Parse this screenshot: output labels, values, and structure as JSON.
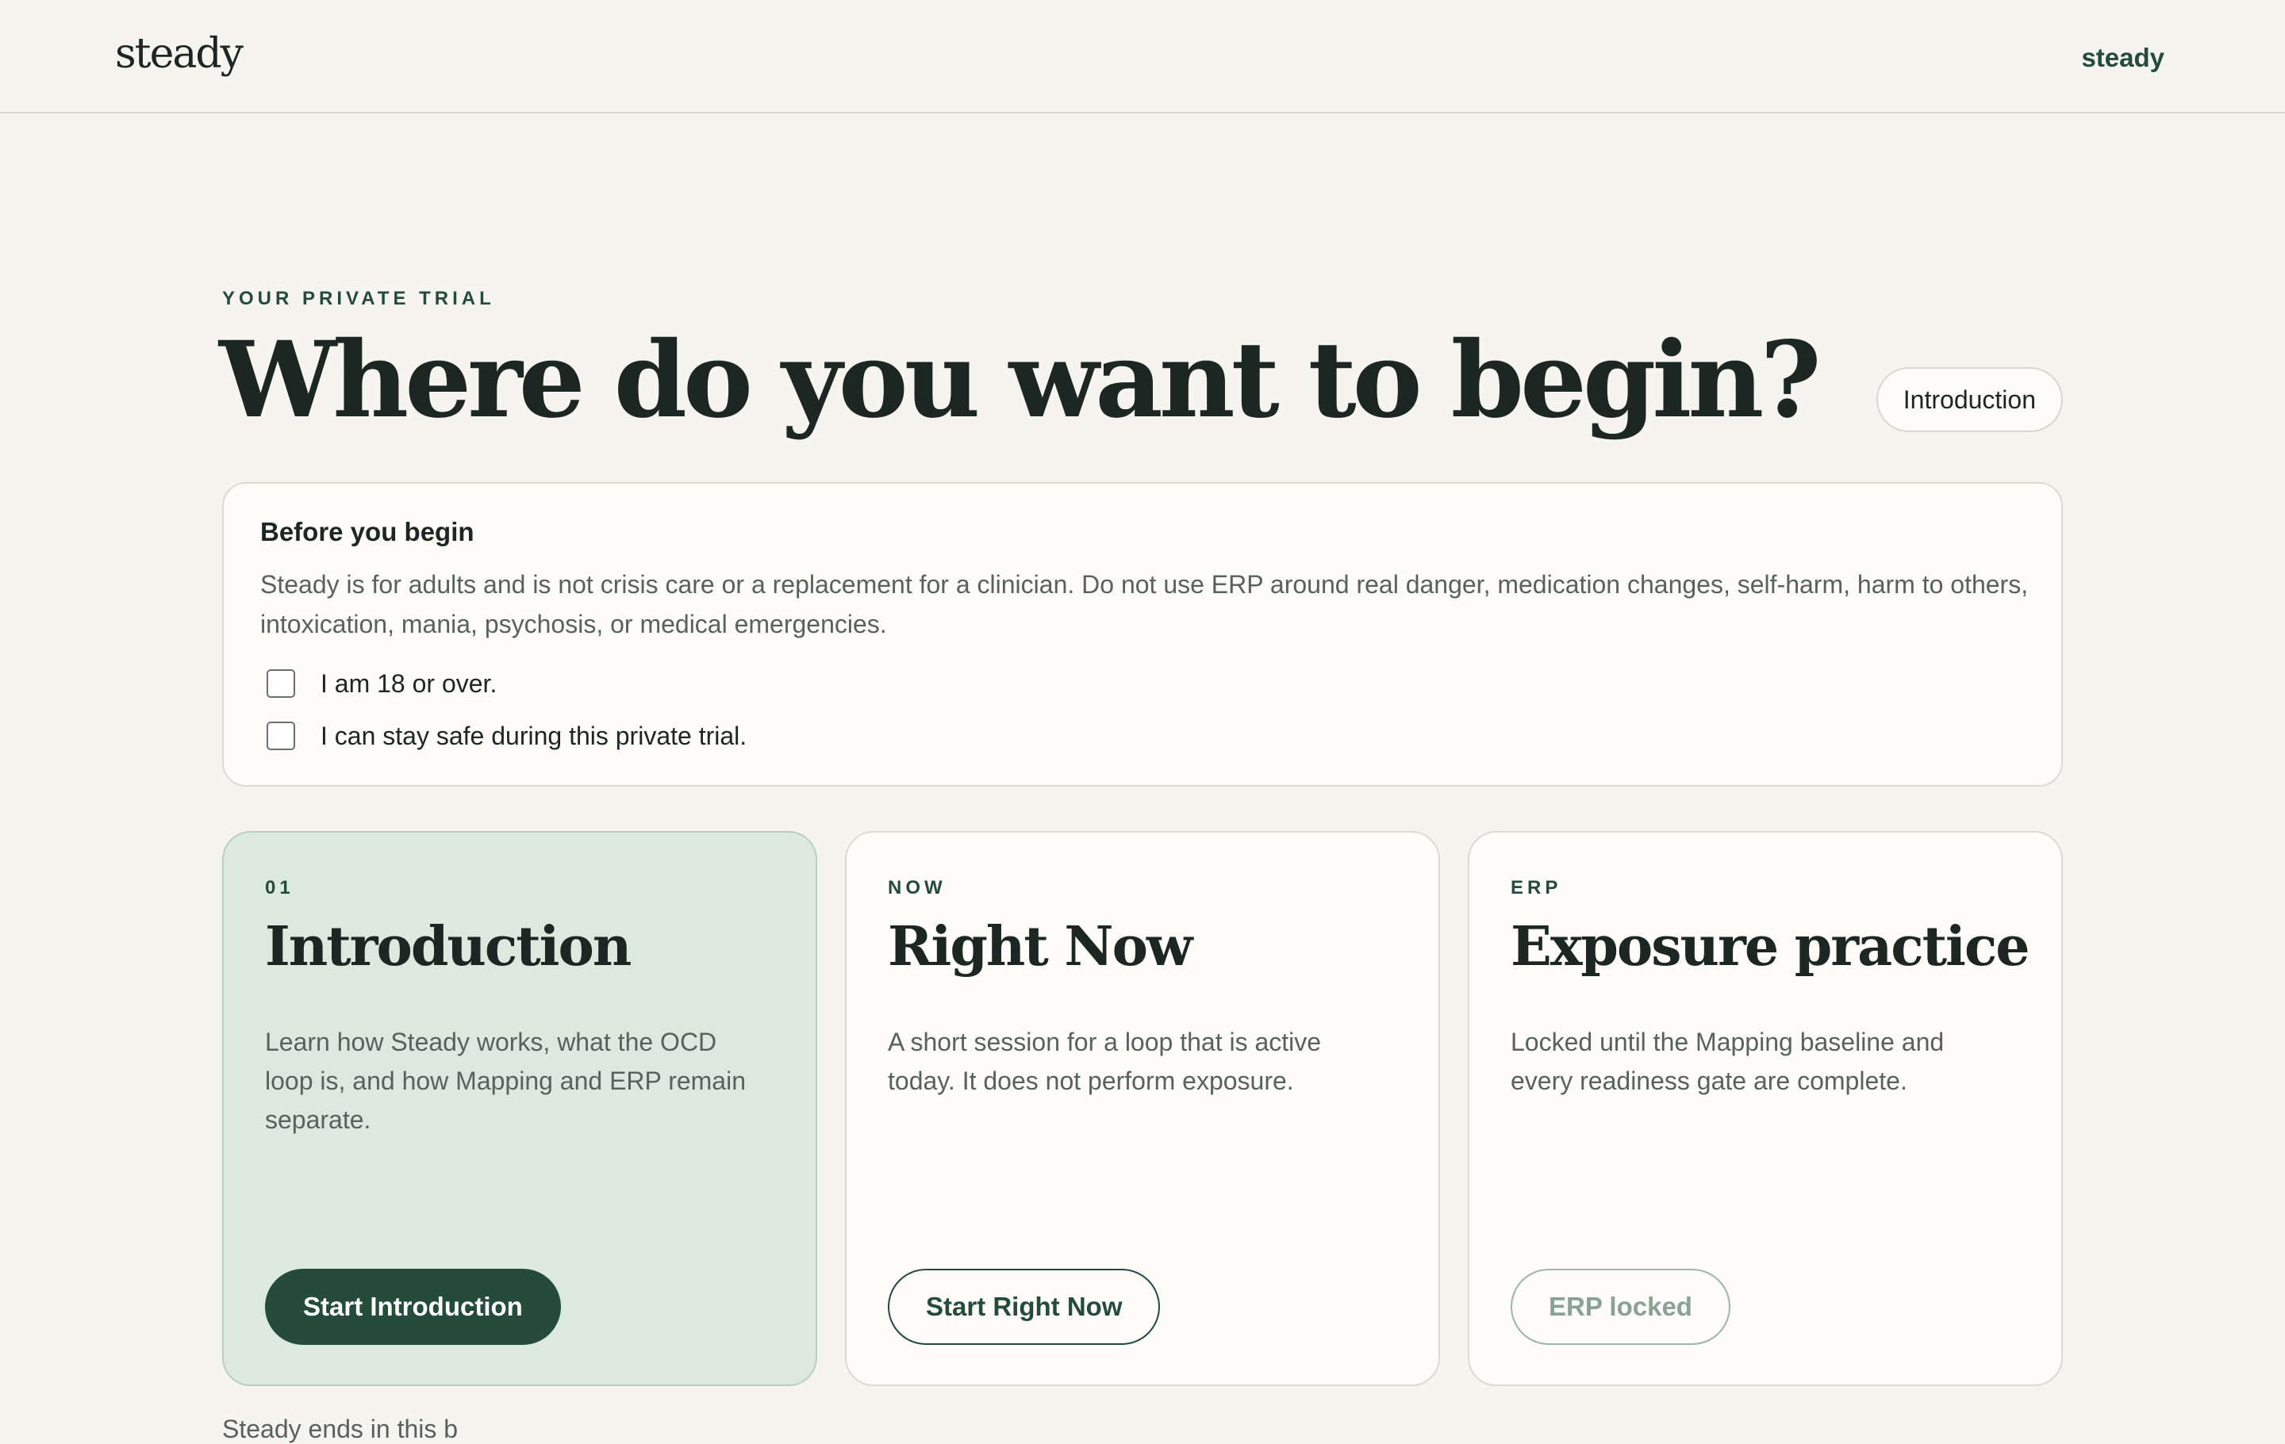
{
  "header": {
    "logo": "steady",
    "nav_link": "steady"
  },
  "hero": {
    "eyebrow": "YOUR PRIVATE TRIAL",
    "title": "Where do you want to begin?",
    "current_step_pill": "Introduction"
  },
  "notice": {
    "title": "Before you begin",
    "body": "Steady is for adults and is not crisis care or a replacement for a clinician. Do not use ERP around real danger, medication changes, self-harm, harm to others, intoxication, mania, psychosis, or medical emergencies.",
    "checks": [
      {
        "label": "I am 18 or over.",
        "checked": false
      },
      {
        "label": "I can stay safe during this private trial.",
        "checked": false
      }
    ]
  },
  "cards": [
    {
      "tag": "01",
      "title": "Introduction",
      "description": "Learn how Steady works, what the OCD loop is, and how Mapping and ERP remain separate.",
      "button": "Start Introduction",
      "state": "active"
    },
    {
      "tag": "NOW",
      "title": "Right Now",
      "description": "A short session for a loop that is active today. It does not perform exposure.",
      "button": "Start Right Now",
      "state": "available"
    },
    {
      "tag": "ERP",
      "title": "Exposure practice",
      "description": "Locked until the Mapping baseline and every readiness gate are complete.",
      "button": "ERP locked",
      "state": "locked"
    }
  ],
  "footer": {
    "text": "Steady ends in this b"
  },
  "colors": {
    "background": "#f6f4ef",
    "accent": "#244b3c",
    "active_card": "#dce9df",
    "muted_text": "#58625d"
  }
}
